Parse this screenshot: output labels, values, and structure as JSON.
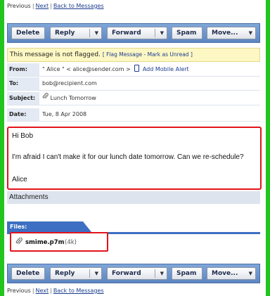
{
  "nav": {
    "previous": "Previous",
    "sep": "|",
    "next": "Next",
    "back": "Back to Messages"
  },
  "toolbar": {
    "delete": "Delete",
    "reply": "Reply",
    "forward": "Forward",
    "spam": "Spam",
    "move": "Move...",
    "dropdown_glyph": "▼"
  },
  "flag": {
    "text": "This message is not flagged.",
    "open_bracket": "[",
    "flag_link": "Flag Message",
    "dash": "-",
    "unread_link": "Mark as Unread",
    "close_bracket": "]"
  },
  "headers": {
    "from_label": "From:",
    "from_value": "\" Alice \" < alice@sender.com >",
    "add_mobile": "Add Mobile Alert",
    "to_label": "To:",
    "to_value": "bob@recipient.com",
    "subject_label": "Subject:",
    "subject_value": "Lunch Tomorrow",
    "date_label": "Date:",
    "date_value": "Tue, 8 Apr 2008"
  },
  "message": {
    "greeting": "Hi Bob",
    "body": "I'm afraid I can't make it for our lunch date tomorrow. Can we re-schedule?",
    "signature": "Alice"
  },
  "attachments": {
    "heading": "Attachments",
    "files_tab": "Files:",
    "file_name": "smime.p7m",
    "file_size": "(4k)"
  },
  "icons": {
    "clip": "paperclip-icon",
    "phone": "mobile-phone-icon"
  },
  "colors": {
    "highlight_red": "#e3141b",
    "toolbar_blue": "#5d86c2",
    "background_green": "#22c51d",
    "link_blue": "#1a3c8e"
  }
}
